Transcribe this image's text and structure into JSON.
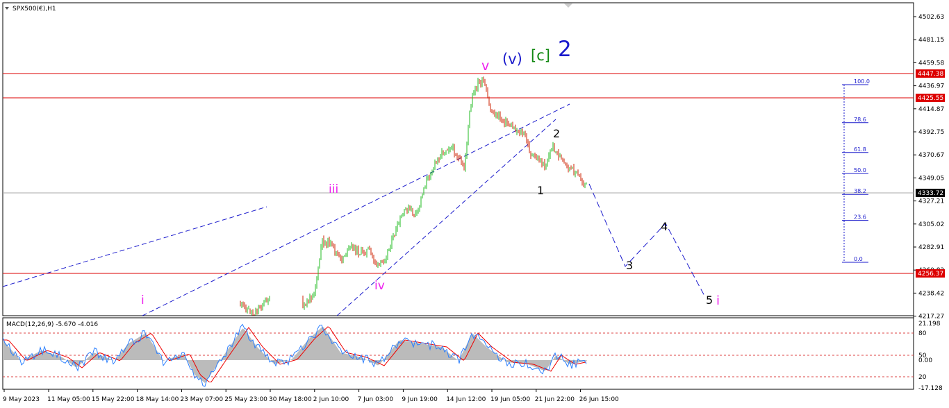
{
  "symbol_label": "SPX500(€),H1",
  "macd_label": "MACD(12,26,9) -5.670 -4.016",
  "colors": {
    "up_candle": "#22bb22",
    "down_candle": "#cc2200",
    "hline": "#dd0000",
    "trendline": "#1a1acc",
    "fib": "#1a1acc",
    "macd_fill": "#bbbbbb",
    "macd_signal": "#ee0000",
    "macd_line": "#2a7fff",
    "wave_magenta": "#ee22ee",
    "wave_blue": "#1a1acc",
    "wave_green": "#118811",
    "price_badge": "#dd0000",
    "current_badge": "#000000"
  },
  "chart_data": {
    "type": "candlestick",
    "price_axis": {
      "range": [
        4212,
        4510
      ],
      "ticks": [
        "4502.63",
        "4481.15",
        "4459.58",
        "4436.97",
        "4414.87",
        "4392.75",
        "4370.67",
        "4349.05",
        "4327.21",
        "4305.02",
        "4282.91",
        "4260.82",
        "4238.42",
        "4217.27"
      ]
    },
    "macd_axis": {
      "range": [
        -35,
        44
      ],
      "ticks": [
        "21.198",
        "80",
        "50",
        "0.00",
        "20",
        "-17.128"
      ]
    },
    "time_axis": [
      "9 May 2023",
      "11 May 05:00",
      "15 May 22:00",
      "18 May 14:00",
      "23 May 07:00",
      "25 May 23:00",
      "30 May 18:00",
      "2 Jun 10:00",
      "7 Jun 03:00",
      "9 Jun 19:00",
      "14 Jun 12:00",
      "19 Jun 05:00",
      "21 Jun 22:00",
      "26 Jun 15:00"
    ],
    "horizontal_levels": [
      {
        "value": 4447.38,
        "label": "4447.38"
      },
      {
        "value": 4425.55,
        "label": "4425.55"
      },
      {
        "value": 4256.37,
        "label": "4256.37"
      }
    ],
    "current_price": {
      "value": 4333.72,
      "label": "4333.72"
    },
    "fibonacci": {
      "high": 4434,
      "low": 4265,
      "levels": [
        {
          "ratio": 1.0,
          "label": "100.0"
        },
        {
          "ratio": 0.786,
          "label": "78.6"
        },
        {
          "ratio": 0.618,
          "label": "61.8"
        },
        {
          "ratio": 0.5,
          "label": "50.0"
        },
        {
          "ratio": 0.382,
          "label": "38.2"
        },
        {
          "ratio": 0.236,
          "label": "23.6"
        },
        {
          "ratio": 0.0,
          "label": "0.0"
        }
      ]
    },
    "wave_labels": [
      {
        "text": "v",
        "color": "magenta"
      },
      {
        "text": "(v)",
        "color": "blue"
      },
      {
        "text": "[c]",
        "color": "green"
      },
      {
        "text": "2",
        "color": "blue"
      },
      {
        "text": "iii",
        "color": "magenta"
      },
      {
        "text": "iv",
        "color": "magenta"
      },
      {
        "text": "i",
        "color": "magenta"
      },
      {
        "text": "1",
        "color": "black"
      },
      {
        "text": "2",
        "color": "black"
      },
      {
        "text": "3",
        "color": "black"
      },
      {
        "text": "4",
        "color": "black"
      },
      {
        "text": "5",
        "color": "black"
      },
      {
        "text": "i",
        "color": "magenta"
      }
    ]
  }
}
